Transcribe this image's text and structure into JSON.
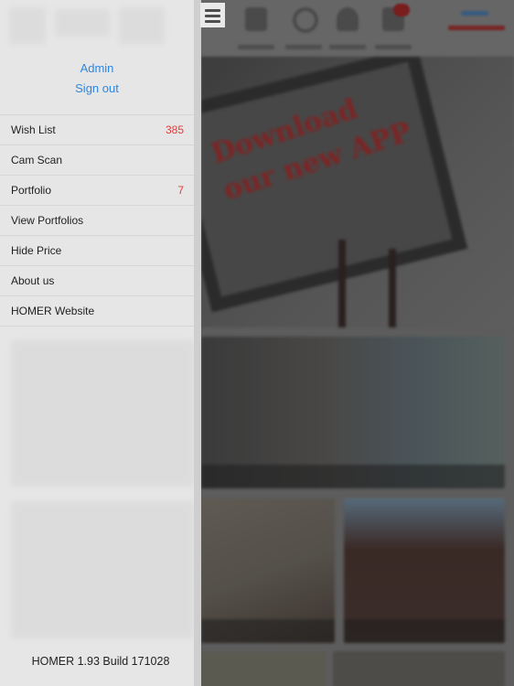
{
  "drawer": {
    "account": {
      "username": "Admin",
      "sign_out_label": "Sign out"
    },
    "menu_items": [
      {
        "id": "wish-list",
        "label": "Wish List",
        "count": "385"
      },
      {
        "id": "cam-scan",
        "label": "Cam Scan",
        "count": ""
      },
      {
        "id": "portfolio",
        "label": "Portfolio",
        "count": "7"
      },
      {
        "id": "view-portfolios",
        "label": "View Portfolios",
        "count": ""
      },
      {
        "id": "hide-price",
        "label": "Hide Price",
        "count": ""
      },
      {
        "id": "about-us",
        "label": "About us",
        "count": ""
      },
      {
        "id": "homer-website",
        "label": "HOMER Website",
        "count": ""
      }
    ],
    "version_text": "HOMER 1.93 Build 171028"
  },
  "menu_button": {
    "icon": "hamburger-menu-icon"
  },
  "background": {
    "dimmed": true,
    "tabs": [
      {
        "icon": "catalog-icon"
      },
      {
        "icon": "search-icon"
      },
      {
        "icon": "contact-icon"
      },
      {
        "icon": "cart-icon"
      }
    ],
    "promo_text": [
      "Download",
      "our new APP"
    ]
  },
  "colors": {
    "link": "#2f86e0",
    "badge_count": "#e23b3b",
    "drawer_bg": "#e6e6e6"
  }
}
